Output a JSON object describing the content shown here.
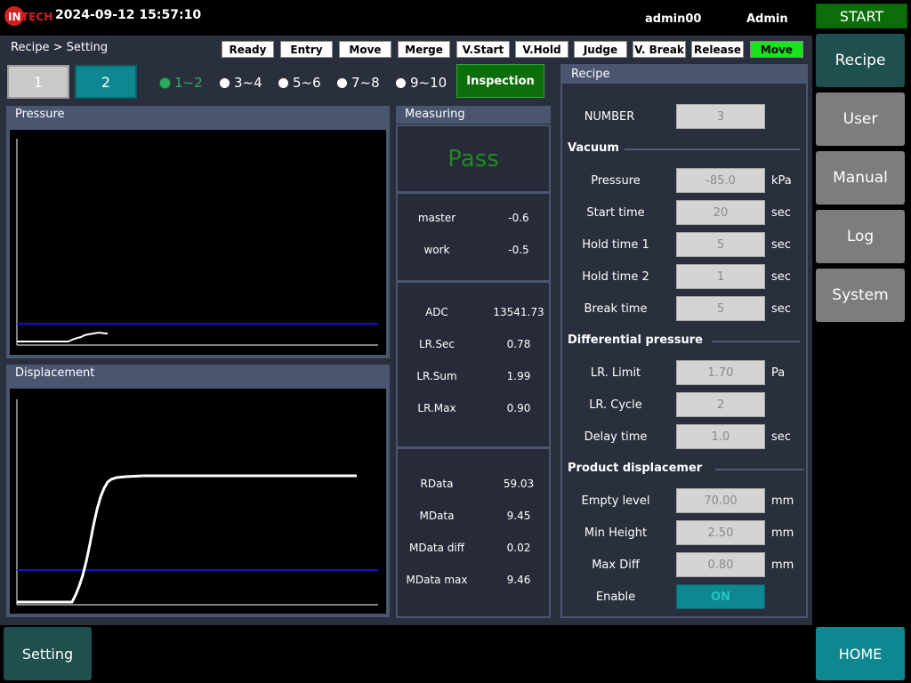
{
  "header": {
    "logo_text": "INTECH",
    "datetime": "2024-09-12 15:57:10",
    "user_id": "admin00",
    "user_role": "Admin",
    "start_label": "START"
  },
  "breadcrumb": "Recipe > Setting",
  "status_indicators": [
    {
      "label": "Ready",
      "active": false
    },
    {
      "label": "Entry",
      "active": false
    },
    {
      "label": "Move",
      "active": false
    },
    {
      "label": "Merge",
      "active": false
    },
    {
      "label": "V.Start",
      "active": false
    },
    {
      "label": "V.Hold",
      "active": false
    },
    {
      "label": "Judge",
      "active": false
    },
    {
      "label": "V. Break",
      "active": false
    },
    {
      "label": "Release",
      "active": false
    },
    {
      "label": "Move",
      "active": true
    }
  ],
  "channels": [
    {
      "label": "1",
      "selected": false
    },
    {
      "label": "2",
      "selected": true
    }
  ],
  "ranges": [
    {
      "label": "1~2",
      "selected": true
    },
    {
      "label": "3~4",
      "selected": false
    },
    {
      "label": "5~6",
      "selected": false
    },
    {
      "label": "7~8",
      "selected": false
    },
    {
      "label": "9~10",
      "selected": false
    }
  ],
  "inspection_label": "Inspection",
  "charts": {
    "pressure_title": "Pressure",
    "displacement_title": "Displacement"
  },
  "measuring": {
    "title": "Measuring",
    "result": "Pass",
    "result_color": "#1f8a1f",
    "group1": [
      {
        "label": "master",
        "value": "-0.6"
      },
      {
        "label": "work",
        "value": "-0.5"
      }
    ],
    "group2": [
      {
        "label": "ADC",
        "value": "13541.73"
      },
      {
        "label": "LR.Sec",
        "value": "0.78"
      },
      {
        "label": "LR.Sum",
        "value": "1.99"
      },
      {
        "label": "LR.Max",
        "value": "0.90"
      }
    ],
    "group3": [
      {
        "label": "RData",
        "value": "59.03"
      },
      {
        "label": "MData",
        "value": "9.45"
      },
      {
        "label": "MData diff",
        "value": "0.02"
      },
      {
        "label": "MData max",
        "value": "9.46"
      }
    ]
  },
  "recipe": {
    "title": "Recipe",
    "number_label": "NUMBER",
    "number_value": "3",
    "sections": {
      "vacuum": "Vacuum",
      "differential": "Differential pressure",
      "product": "Product displacemer"
    },
    "vacuum_fields": [
      {
        "label": "Pressure",
        "value": "-85.0",
        "unit": "kPa"
      },
      {
        "label": "Start time",
        "value": "20",
        "unit": "sec"
      },
      {
        "label": "Hold time 1",
        "value": "5",
        "unit": "sec"
      },
      {
        "label": "Hold time 2",
        "value": "1",
        "unit": "sec"
      },
      {
        "label": "Break time",
        "value": "5",
        "unit": "sec"
      }
    ],
    "diff_fields": [
      {
        "label": "LR. Limit",
        "value": "1.70",
        "unit": "Pa"
      },
      {
        "label": "LR. Cycle",
        "value": "2",
        "unit": ""
      },
      {
        "label": "Delay time",
        "value": "1.0",
        "unit": "sec"
      }
    ],
    "product_fields": [
      {
        "label": "Empty level",
        "value": "70.00",
        "unit": "mm"
      },
      {
        "label": "Min Height",
        "value": "2.50",
        "unit": "mm"
      },
      {
        "label": "Max Diff",
        "value": "0.80",
        "unit": "mm"
      }
    ],
    "enable_label": "Enable",
    "enable_value": "ON"
  },
  "sidebar": {
    "items": [
      {
        "label": "Recipe",
        "active": true
      },
      {
        "label": "User",
        "active": false
      },
      {
        "label": "Manual",
        "active": false
      },
      {
        "label": "Log",
        "active": false
      },
      {
        "label": "System",
        "active": false
      }
    ]
  },
  "footer": {
    "setting_label": "Setting",
    "home_label": "HOME"
  },
  "colors": {
    "accent_teal": "#0f8790",
    "active_green": "#17e41a",
    "start_green": "#0b6e0b",
    "panel_bg": "#2a2f3d"
  }
}
